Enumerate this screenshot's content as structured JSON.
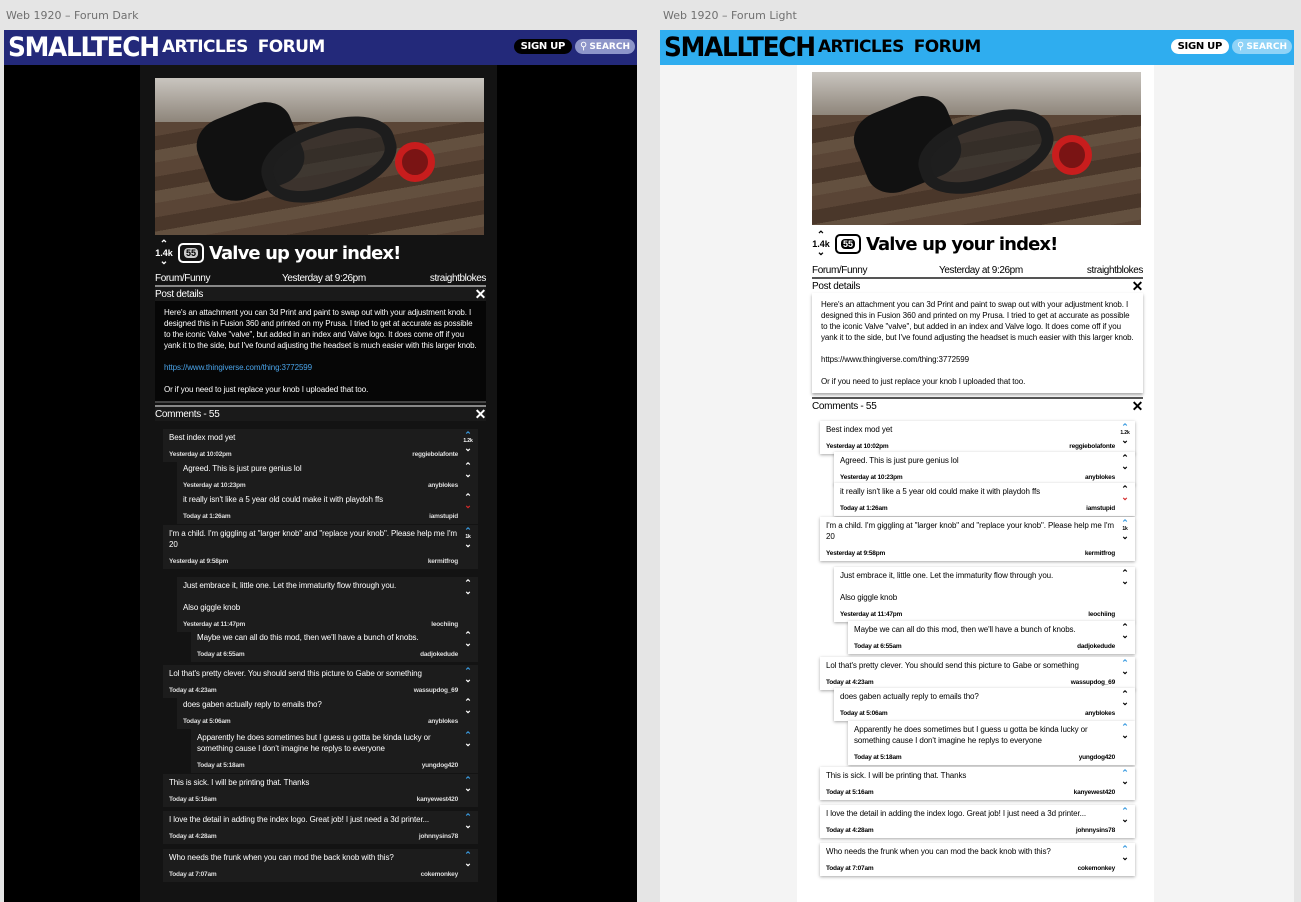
{
  "artboards": [
    {
      "label": "Web 1920 – Forum Dark"
    },
    {
      "label": "Web 1920 – Forum Light"
    }
  ],
  "header": {
    "logo": "SMALLTECH",
    "nav": [
      "ARTICLES",
      "FORUM"
    ],
    "signup": "SIGN UP",
    "search": "SEARCH",
    "search_icon": "magnifier-icon"
  },
  "post": {
    "votes": "1.4k",
    "comment_count": "55",
    "title": "Valve up your index!",
    "category": "Forum/Funny",
    "timestamp": "Yesterday at 9:26pm",
    "author": "straightblokes",
    "details_label": "Post details",
    "body": [
      "Here's an attachment you can 3d Print and paint to swap out with your adjustment knob. I designed this in Fusion 360 and printed on my Prusa. I tried to get at accurate as possible to the iconic Valve \"valve\", but added in an index and Valve logo. It does come off if you yank it to the side, but I've found adjusting the headset is much easier with this larger knob.",
      "https://www.thingiverse.com/thing:3772599",
      "Or if you need to just replace your knob I uploaded that too."
    ]
  },
  "comments_label": "Comments - 55",
  "comments": [
    {
      "text": "Best index mod yet",
      "time": "Yesterday at 10:02pm",
      "user": "reggiebolafonte",
      "level": 0,
      "score": "1.2k",
      "vote": "up"
    },
    {
      "text": "Agreed. This is just pure genius lol",
      "time": "Yesterday at 10:23pm",
      "user": "anyblokes",
      "level": 1,
      "score": "",
      "vote": ""
    },
    {
      "text": "it really isn't like a 5 year old could make it with playdoh ffs",
      "time": "Today at 1:26am",
      "user": "iamstupid",
      "level": 1,
      "score": "",
      "vote": "down"
    },
    {
      "text": "I'm a child. I'm giggling at \"larger knob\" and \"replace your knob\". Please help me I'm 20",
      "time": "Yesterday at 9:58pm",
      "user": "kermitfrog",
      "level": 0,
      "score": "1k",
      "vote": "up"
    },
    {
      "text": "Just embrace it, little one. Let the immaturity flow through you.",
      "text2": "Also giggle knob",
      "time": "Yesterday at 11:47pm",
      "user": "leochiing",
      "level": 1,
      "score": "",
      "vote": ""
    },
    {
      "text": "Maybe we can all do this mod, then we'll have a bunch of knobs.",
      "time": "Today at 6:55am",
      "user": "dadjokedude",
      "level": 2,
      "score": "",
      "vote": ""
    },
    {
      "text": "Lol that's pretty clever. You should send this picture to Gabe or something",
      "time": "Today at 4:23am",
      "user": "wassupdog_69",
      "level": 0,
      "score": "",
      "vote": "up"
    },
    {
      "text": "does gaben actually reply to emails tho?",
      "time": "Today at 5:06am",
      "user": "anyblokes",
      "level": 1,
      "score": "",
      "vote": ""
    },
    {
      "text": "Apparently he does sometimes but I guess u gotta be kinda lucky or something cause I don't imagine he replys to everyone",
      "time": "Today at 5:18am",
      "user": "yungdog420",
      "level": 2,
      "score": "",
      "vote": "up"
    },
    {
      "text": "This is sick. I will be printing that. Thanks",
      "time": "Today at 5:16am",
      "user": "kanyewest420",
      "level": 0,
      "score": "",
      "vote": "up"
    },
    {
      "text": "I love the detail in adding the index logo. Great job! I just need a 3d printer...",
      "time": "Today at 4:28am",
      "user": "johnnysins78",
      "level": 0,
      "score": "",
      "vote": "up"
    },
    {
      "text": "Who needs the frunk when you can mod the back knob with this?",
      "time": "Today at 7:07am",
      "user": "cokemonkey",
      "level": 0,
      "score": "",
      "vote": "up"
    }
  ],
  "colors": {
    "dark_header": "#23297a",
    "light_header": "#2fadef",
    "upvote": "#3a9be0",
    "downvote": "#d42a2a"
  }
}
